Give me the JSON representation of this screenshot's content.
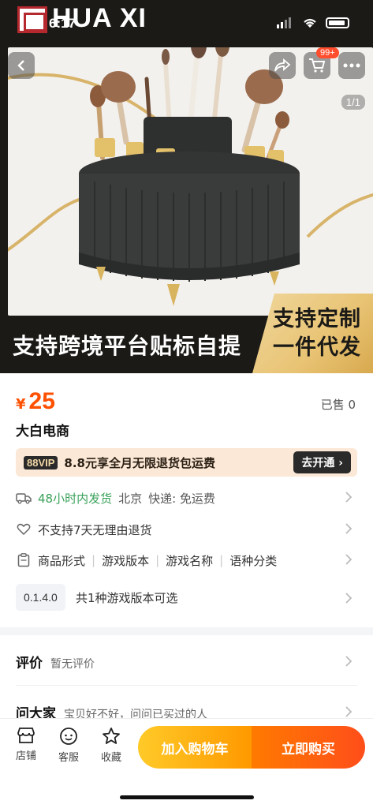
{
  "status_bar": {
    "time": "6:17"
  },
  "brand": {
    "logo_text": "HUA XI"
  },
  "header": {
    "cart_badge": "99+"
  },
  "gallery": {
    "page_indicator": "1/1"
  },
  "banner": {
    "left_text": "支持跨境平台贴标自提",
    "right_line1": "支持定制",
    "right_line2": "一件代发"
  },
  "product": {
    "currency": "¥",
    "price": "25",
    "sold": "已售 0",
    "shop_name": "大白电商"
  },
  "vip": {
    "tag": "88VIP",
    "text": "8.8元享全月无限退货包运费",
    "button": "去开通"
  },
  "shipping": {
    "time": "48小时内发货",
    "origin": "北京",
    "express": "快递: 免运费"
  },
  "returns": {
    "text": "不支持7天无理由退货"
  },
  "specs": {
    "items": [
      "商品形式",
      "游戏版本",
      "游戏名称",
      "语种分类"
    ]
  },
  "version": {
    "chip": "0.1.4.0",
    "text": "共1种游戏版本可选"
  },
  "reviews": {
    "title": "评价",
    "sub": "暂无评价"
  },
  "qa": {
    "title": "问大家",
    "sub": "宝贝好不好，问问已买过的人"
  },
  "bottom_bar": {
    "shop": "店铺",
    "service": "客服",
    "favorite": "收藏",
    "add_to_cart": "加入购物车",
    "buy_now": "立即购买"
  },
  "colors": {
    "price": "#ff5000",
    "accent_green": "#3aa15a",
    "cart_button": "#ffb300",
    "buy_button": "#ff5a14",
    "banner_gold": "#e8c373"
  }
}
